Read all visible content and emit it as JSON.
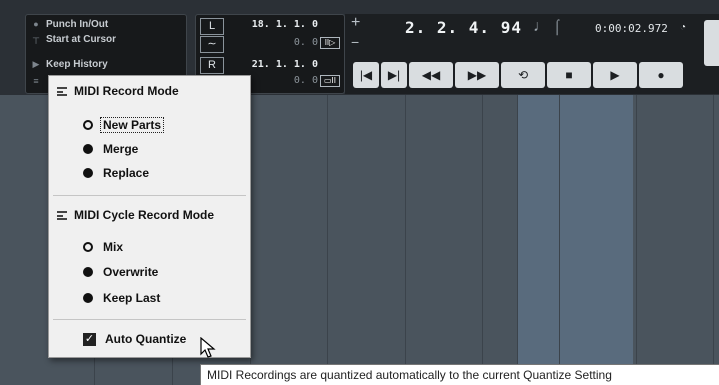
{
  "record_mode_panel": {
    "rows": [
      "Punch In/Out",
      "Start at Cursor",
      "Keep History",
      ""
    ],
    "icons": [
      "dot-icon",
      "arrow-down-icon",
      "play-icon",
      "lines-icon"
    ]
  },
  "locators": {
    "left_label": "L",
    "right_label": "R",
    "left_value": "18. 1. 1.   0",
    "left_sub": "0.   0",
    "right_value": "21. 1. 1.   0",
    "right_sub": "0.   0"
  },
  "position": {
    "main": "2. 2. 4. 94",
    "time": "0:00:02.972"
  },
  "transport_buttons": [
    "go-to-start",
    "go-to-end",
    "rewind",
    "fast-forward",
    "cycle",
    "stop",
    "play",
    "record"
  ],
  "menu": {
    "midi_record_mode": {
      "heading": "MIDI Record Mode",
      "options": [
        {
          "label": "New Parts",
          "selected": true
        },
        {
          "label": "Merge",
          "selected": false
        },
        {
          "label": "Replace",
          "selected": false
        }
      ]
    },
    "midi_cycle_record_mode": {
      "heading": "MIDI Cycle Record Mode",
      "options": [
        {
          "label": "Mix",
          "selected": true
        },
        {
          "label": "Overwrite",
          "selected": false
        },
        {
          "label": "Keep Last",
          "selected": false
        }
      ]
    },
    "auto_quantize": {
      "label": "Auto Quantize",
      "checked": true
    }
  },
  "tooltip": "MIDI Recordings are quantized automatically to the current Quantize Setting"
}
